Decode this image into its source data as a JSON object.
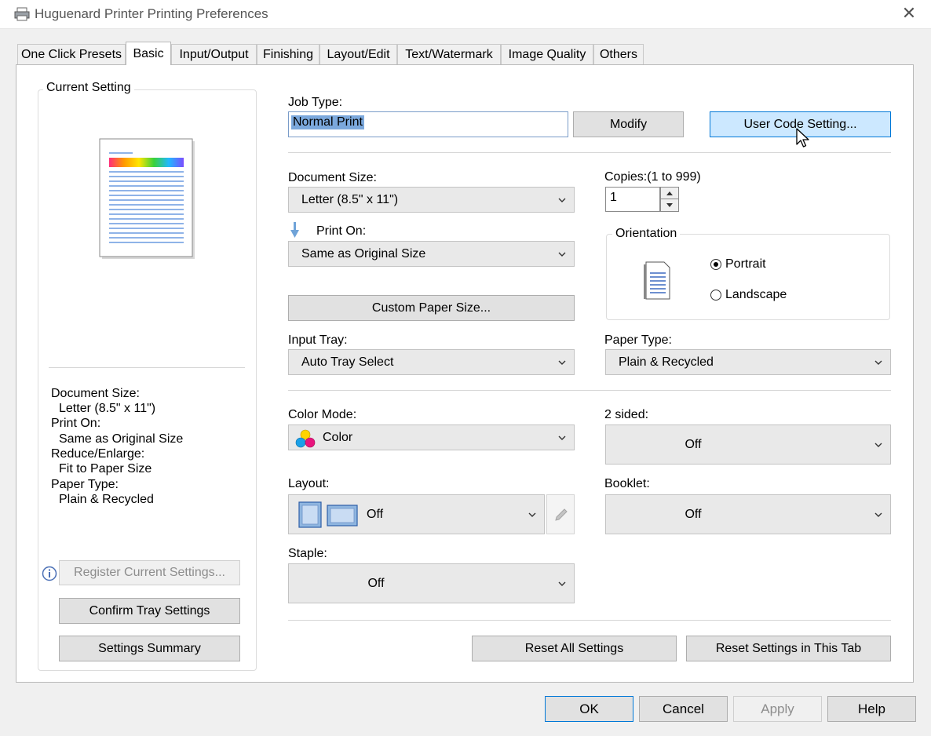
{
  "window": {
    "title": "Huguenard Printer Printing Preferences"
  },
  "tabs": [
    {
      "label": "One Click Presets"
    },
    {
      "label": "Basic"
    },
    {
      "label": "Input/Output"
    },
    {
      "label": "Finishing"
    },
    {
      "label": "Layout/Edit"
    },
    {
      "label": "Text/Watermark"
    },
    {
      "label": "Image Quality"
    },
    {
      "label": "Others"
    }
  ],
  "current_setting": {
    "title": "Current Setting",
    "summary": [
      {
        "key": "Document Size:",
        "value": "Letter (8.5\" x 11\")"
      },
      {
        "key": "Print On:",
        "value": "Same as Original Size"
      },
      {
        "key": "Reduce/Enlarge:",
        "value": "Fit to Paper Size"
      },
      {
        "key": "Paper Type:",
        "value": "Plain & Recycled"
      }
    ],
    "register_label": "Register Current Settings...",
    "confirm_tray_label": "Confirm Tray Settings",
    "settings_summary_label": "Settings Summary"
  },
  "job_type": {
    "label": "Job Type:",
    "value": "Normal Print",
    "modify_label": "Modify",
    "user_code_label": "User Code Setting..."
  },
  "document_size": {
    "label": "Document Size:",
    "value": "Letter (8.5\" x 11\")"
  },
  "print_on": {
    "label": "Print On:",
    "value": "Same as Original Size"
  },
  "custom_paper_label": "Custom Paper Size...",
  "copies": {
    "label": "Copies:(1 to 999)",
    "value": "1"
  },
  "orientation": {
    "label": "Orientation",
    "portrait": "Portrait",
    "landscape": "Landscape",
    "selected": "Portrait"
  },
  "input_tray": {
    "label": "Input Tray:",
    "value": "Auto Tray Select"
  },
  "paper_type": {
    "label": "Paper Type:",
    "value": "Plain & Recycled"
  },
  "color_mode": {
    "label": "Color Mode:",
    "value": "Color"
  },
  "two_sided": {
    "label": "2 sided:",
    "value": "Off"
  },
  "layout": {
    "label": "Layout:",
    "value": "Off"
  },
  "booklet": {
    "label": "Booklet:",
    "value": "Off"
  },
  "staple": {
    "label": "Staple:",
    "value": "Off"
  },
  "reset_all_label": "Reset All Settings",
  "reset_tab_label": "Reset Settings in This Tab",
  "footer": {
    "ok": "OK",
    "cancel": "Cancel",
    "apply": "Apply",
    "help": "Help"
  },
  "colors": {
    "accent": "#0078d7",
    "hover_fill": "#cce8ff"
  }
}
